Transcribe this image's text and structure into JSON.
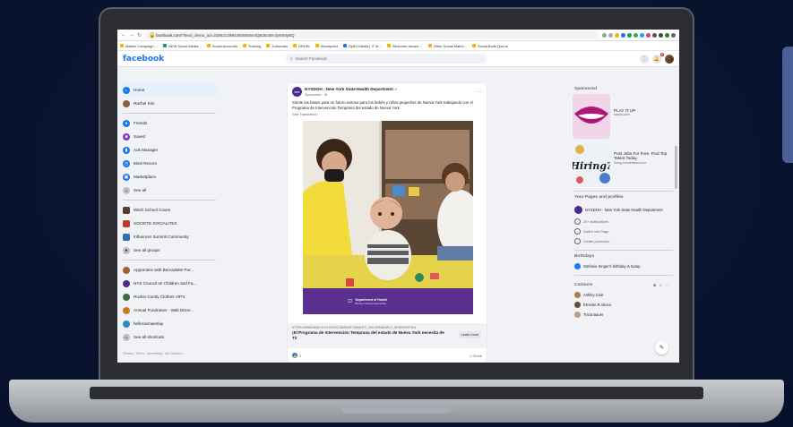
{
  "browser": {
    "url_host": "facebook.com",
    "url_path": "/?feed_demo_ad=23852129843505806n4QBd6c58-dy9nMyBQ",
    "bookmarks": [
      "Master Campaign ...",
      "NEW Social Media...",
      "Social Accounts",
      "Training",
      "Justworks",
      "DRHW",
      "Sharepoint",
      "OptID Media | IT M...",
      "Welcome Issues ...",
      "Other Social Matrix...",
      "Social Build Queue"
    ]
  },
  "facebook": {
    "logo": "facebook",
    "search_placeholder": "Search Facebook",
    "notifications_count": "8"
  },
  "left_nav": {
    "items": [
      {
        "label": "Home",
        "color": "#1877f2"
      },
      {
        "label": "Rachel Kim",
        "color": "#8b5e3c"
      },
      {
        "label": "Friends",
        "color": "#1877f2"
      },
      {
        "label": "Saved",
        "color": "#8a3ab9"
      },
      {
        "label": "Ads Manager",
        "color": "#1877f2"
      },
      {
        "label": "Most Recent",
        "color": "#1877f2"
      },
      {
        "label": "Marketplace",
        "color": "#1877f2"
      },
      {
        "label": "See all",
        "color": "#65676b"
      }
    ],
    "groups": [
      {
        "label": "Witch School Coven",
        "color": "#5b3d2b"
      },
      {
        "label": "SOCIETE SOCIALITES",
        "color": "#c0392b"
      },
      {
        "label": "Influencer Summit Community",
        "color": "#2c6fb7"
      },
      {
        "label": "See all groups",
        "color": "#65676b"
      }
    ],
    "shortcuts": [
      {
        "label": "Apprentice with Bernadette Pur...",
        "color": "#a85a3a"
      },
      {
        "label": "NYS Council on Children and Fa...",
        "color": "#4b2a8c"
      },
      {
        "label": "Ruckin Comfy Clothes VIP's",
        "color": "#3a6b4c"
      },
      {
        "label": "Annual Fundraiser - Walt Disne...",
        "color": "#c47c1e"
      },
      {
        "label": "hellocarinaenlay",
        "color": "#2b89c6"
      },
      {
        "label": "See all shortcuts",
        "color": "#65676b"
      }
    ],
    "footer": "Privacy · Terms · Advertising · Ad Choices ▷"
  },
  "post": {
    "page_name": "NYSDOH - New York State Health Department",
    "avatar_text": "NYS",
    "sub": "Sponsored · ⊕",
    "text": "Siente las bases para un futuro exitoso para los bebés y niños pequeños de Nueva York trabajando con el Programa de Intervención Temprana del estado de Nueva York.",
    "see_translation": "See Translation",
    "image_strip_title": "Department of Health",
    "image_strip_sub": "Bureau of Early Intervention",
    "link_url": "HTTPS://WWW.HEALTH.NY.GOV/COMMUNITY/INFANTS_CHILDREN/EARLY_INTERVENTION/",
    "link_title": "¡El Programa de Intervención Temprana del estado de Nueva York necesita de Ti!",
    "learn_more": "Learn more",
    "likes": "1",
    "shares": "1 Share"
  },
  "right_col": {
    "sponsored_label": "Sponsored",
    "ads": [
      {
        "title": "PLAY IT UP",
        "domain": "sanoo.com"
      },
      {
        "title": "Post Jobs For Free. Find Top Talent Today.",
        "domain": "hiring.com/indeed.com"
      }
    ],
    "pages_label": "Your Pages and profiles",
    "page_name": "NYSDOH - New York State Health Department",
    "page_actions": [
      "20+ Notifications",
      "Switch into Page",
      "Create promotion"
    ],
    "birthdays_label": "Birthdays",
    "birthday_text": "Stefanie Singer's birthday is today.",
    "contacts_label": "Contacts",
    "contacts": [
      {
        "name": "Ashley Cole",
        "color": "#b07a4a"
      },
      {
        "name": "Ernesto R Alicea",
        "color": "#6a4a3a"
      },
      {
        "name": "Tricia Bauer",
        "color": "#c49a7a"
      }
    ]
  }
}
